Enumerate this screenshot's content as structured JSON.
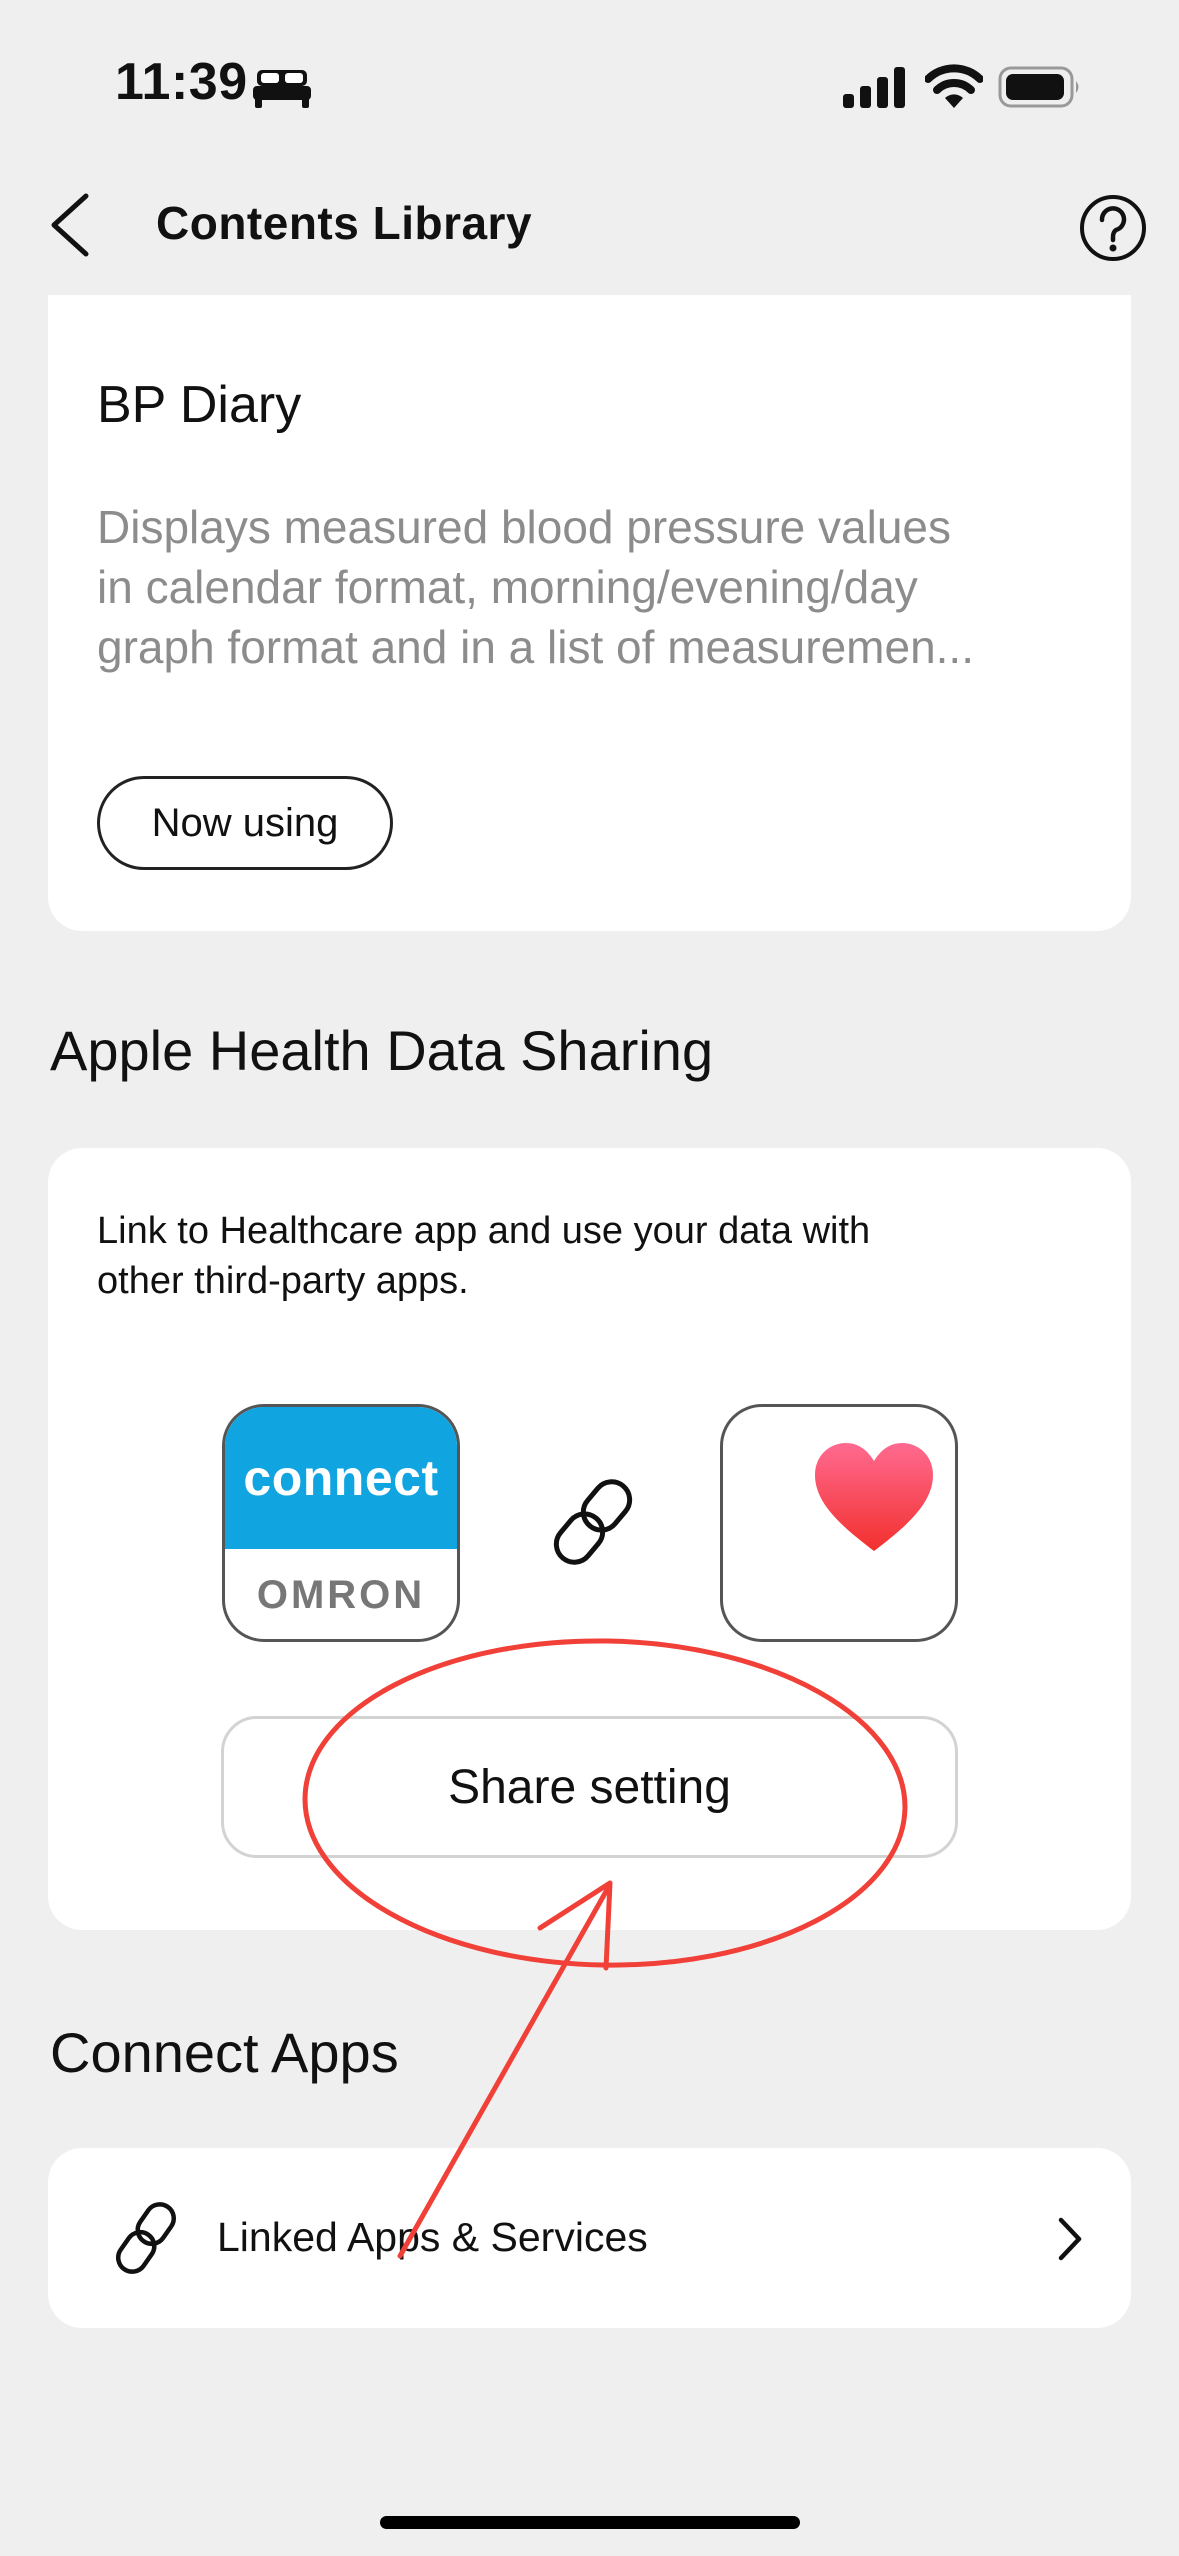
{
  "status_bar": {
    "time": "11:39",
    "icons": [
      "bed-icon",
      "signal-icon",
      "wifi-icon",
      "battery-icon"
    ]
  },
  "header": {
    "title": "Contents Library",
    "back_icon": "chevron-left-icon",
    "help_icon": "question-circle-icon"
  },
  "bp_card": {
    "title": "BP Diary",
    "description_lines": [
      "Displays measured blood pressure values",
      "in calendar format, morning/evening/day",
      "graph format and in a list of measuremen..."
    ],
    "status_button": "Now using"
  },
  "apple_health": {
    "section_title": "Apple Health Data Sharing",
    "description_lines": [
      "Link to Healthcare app and use your data with",
      "other third-party apps."
    ],
    "connect_logo_top": "connect",
    "connect_logo_bottom": "OMRON",
    "share_button": "Share setting"
  },
  "connect_apps": {
    "section_title": "Connect Apps",
    "item_label": "Linked Apps & Services"
  },
  "colors": {
    "background": "#efefef",
    "card": "#ffffff",
    "connect_blue": "#10a4e0",
    "annotation_red": "#f04038",
    "heart_top": "#ff6a90",
    "heart_bottom": "#f2302d"
  }
}
